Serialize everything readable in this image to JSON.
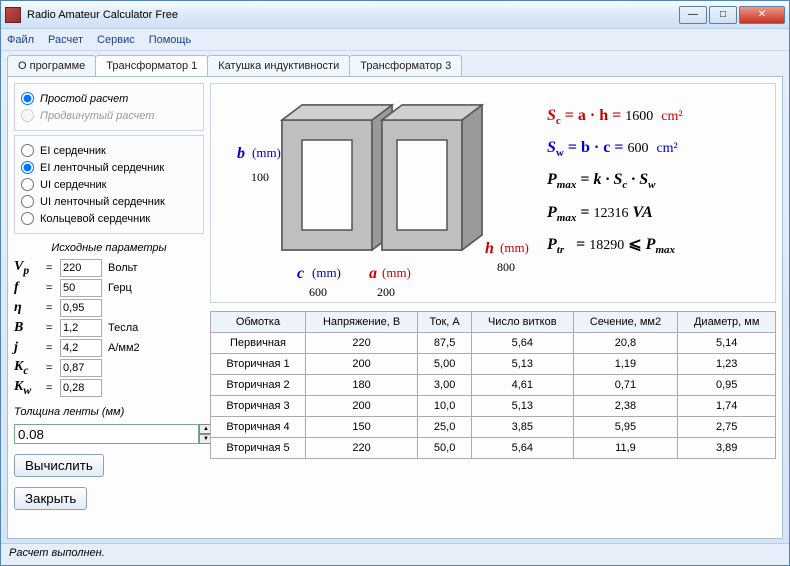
{
  "window": {
    "title": "Radio Amateur Calculator Free"
  },
  "menu": [
    "Файл",
    "Расчет",
    "Сервис",
    "Помощь"
  ],
  "tabs": [
    "О программе",
    "Трансформатор 1",
    "Катушка индуктивности",
    "Трансформатор 3"
  ],
  "active_tab": 1,
  "calc_mode": {
    "simple": "Простой расчет",
    "advanced": "Продвинутый расчет"
  },
  "core_types": [
    "EI сердечник",
    "EI ленточный сердечник",
    "UI сердечник",
    "UI ленточный сердечник",
    "Кольцевой сердечник"
  ],
  "core_selected": 1,
  "params_title": "Исходные параметры",
  "params": {
    "Vp": {
      "sym": "V",
      "sub": "p",
      "val": "220",
      "unit": "Вольт"
    },
    "f": {
      "sym": "f",
      "sub": "",
      "val": "50",
      "unit": "Герц"
    },
    "eta": {
      "sym": "η",
      "sub": "",
      "val": "0,95",
      "unit": ""
    },
    "B": {
      "sym": "B",
      "sub": "",
      "val": "1,2",
      "unit": "Тесла"
    },
    "j": {
      "sym": "j",
      "sub": "",
      "val": "4,2",
      "unit": "А/мм2"
    },
    "Kc": {
      "sym": "K",
      "sub": "c",
      "val": "0,87",
      "unit": ""
    },
    "Kw": {
      "sym": "K",
      "sub": "w",
      "val": "0,28",
      "unit": ""
    }
  },
  "thickness": {
    "label": "Толщина ленты (мм)",
    "val": "0.08"
  },
  "buttons": {
    "calc": "Вычислить",
    "close": "Закрыть"
  },
  "dims": {
    "b": {
      "label": "b",
      "mm": "(mm)",
      "val": "100"
    },
    "c": {
      "label": "c",
      "mm": "(mm)",
      "val": "600"
    },
    "a": {
      "label": "a",
      "mm": "(mm)",
      "val": "200"
    },
    "h": {
      "label": "h",
      "mm": "(mm)",
      "val": "800"
    }
  },
  "formulas": {
    "Sc": {
      "expr": "S",
      "sub": "c",
      "eq": " = a · h = ",
      "val": "1600",
      "unit": "cm²"
    },
    "Sw": {
      "expr": "S",
      "sub": "w",
      "eq": " = b · c = ",
      "val": "600",
      "unit": "cm²"
    },
    "Pmax_expr": "Pₘₐₓ = k · S꜀ · Sᵥᵥ",
    "Pmax": {
      "val": "12316",
      "unit": "VA"
    },
    "Ptr": {
      "val": "18290"
    }
  },
  "table": {
    "headers": [
      "Обмотка",
      "Напряжение, В",
      "Ток, А",
      "Число витков",
      "Сечение, мм2",
      "Диаметр, мм"
    ],
    "rows": [
      [
        "Первичная",
        "220",
        "87,5",
        "5,64",
        "20,8",
        "5,14"
      ],
      [
        "Вторичная 1",
        "200",
        "5,00",
        "5,13",
        "1,19",
        "1,23"
      ],
      [
        "Вторичная 2",
        "180",
        "3,00",
        "4,61",
        "0,71",
        "0,95"
      ],
      [
        "Вторичная 3",
        "200",
        "10,0",
        "5,13",
        "2,38",
        "1,74"
      ],
      [
        "Вторичная 4",
        "150",
        "25,0",
        "3,85",
        "5,95",
        "2,75"
      ],
      [
        "Вторичная 5",
        "220",
        "50,0",
        "5,64",
        "11,9",
        "3,89"
      ]
    ]
  },
  "status": "Расчет выполнен."
}
